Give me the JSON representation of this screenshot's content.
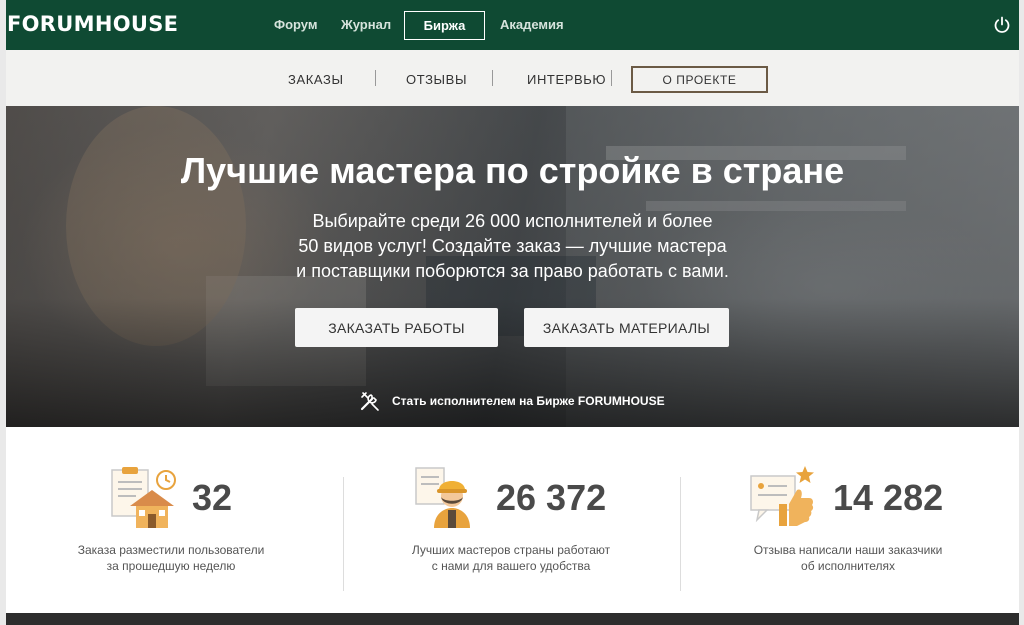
{
  "topnav": {
    "logo": "FORUMHOUSE",
    "links": [
      "Форум",
      "Журнал",
      "Биржа",
      "Академия"
    ]
  },
  "subnav": {
    "links": [
      "ЗАКАЗЫ",
      "ОТЗЫВЫ",
      "ИНТЕРВЬЮ",
      "О ПРОЕКТЕ"
    ]
  },
  "hero": {
    "title": "Лучшие мастера по стройке в стране",
    "lines": [
      "Выбирайте среди 26 000 исполнителей и более",
      "50 видов услуг! Создайте заказ — лучшие мастера",
      "и поставщики поборются за право работать с вами."
    ],
    "btn_works": "ЗАКАЗАТЬ РАБОТЫ",
    "btn_materials": "ЗАКАЗАТЬ МАТЕРИАЛЫ",
    "become_link": "Стать исполнителем на Бирже FORUMHOUSE"
  },
  "stats": [
    {
      "icon": "orders-house-icon",
      "number": "32",
      "desc_lines": [
        "Заказа разместили пользователи",
        "за прошедшую неделю"
      ]
    },
    {
      "icon": "builder-worker-icon",
      "number": "26 372",
      "desc_lines": [
        "Лучших мастеров страны работают",
        "с нами для вашего удобства"
      ]
    },
    {
      "icon": "review-thumbs-up-icon",
      "number": "14 282",
      "desc_lines": [
        "Отзыва написали наши заказчики",
        "об исполнителях"
      ]
    }
  ],
  "colors": {
    "brand": "#0f4a33",
    "accent_orange": "#e8a33d"
  }
}
